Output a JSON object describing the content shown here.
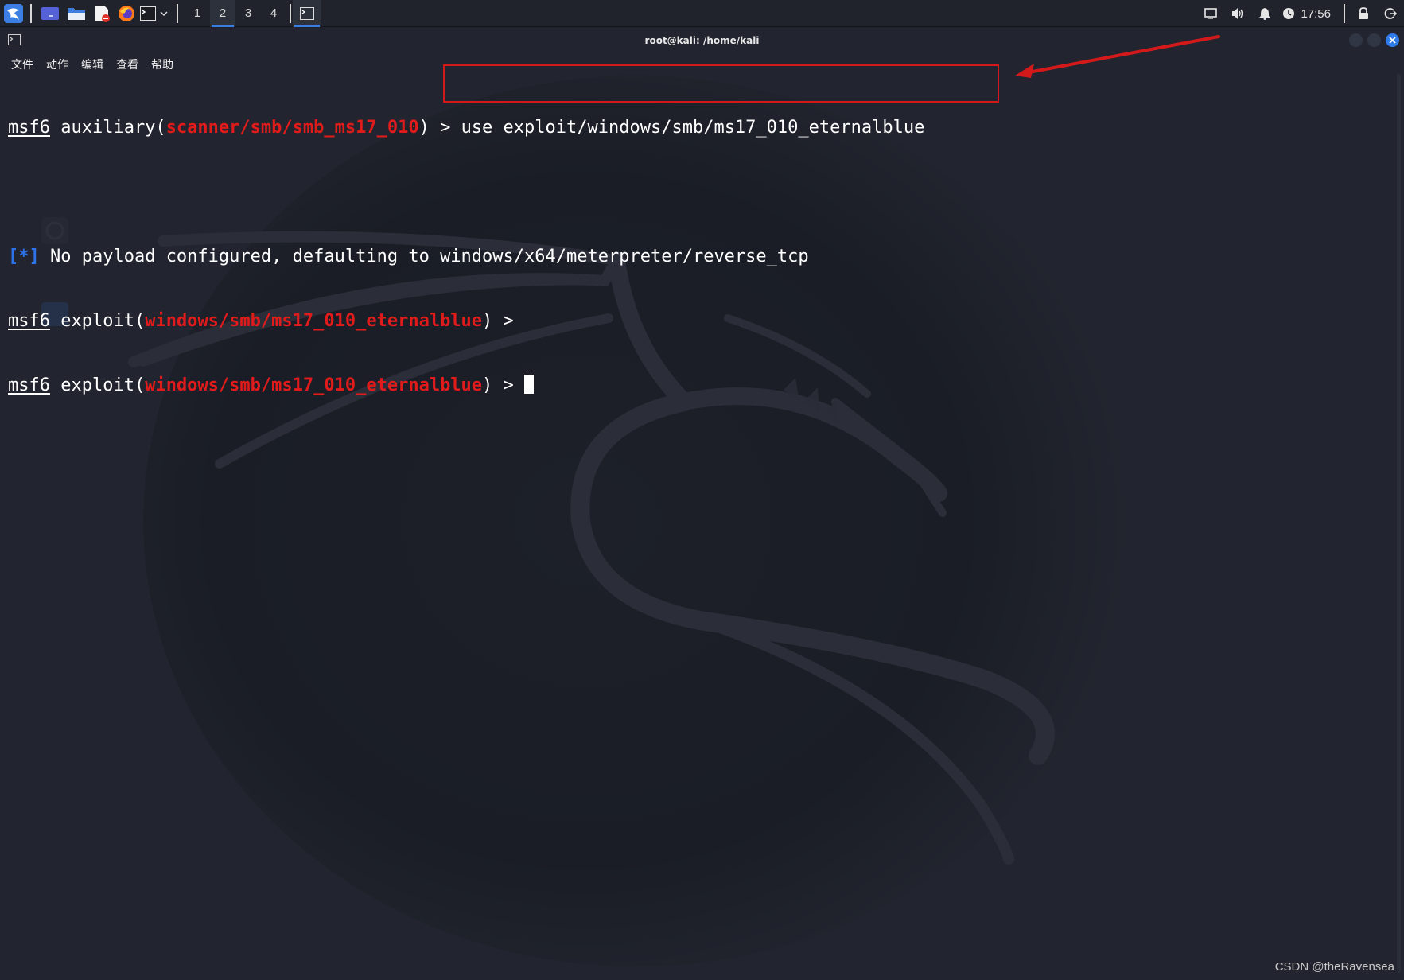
{
  "taskbar": {
    "workspaces": [
      "1",
      "2",
      "3",
      "4"
    ],
    "active_workspace": "2",
    "clock": "17:56",
    "accent_color": "#3a7fe0"
  },
  "window": {
    "title": "root@kali: /home/kali",
    "menu": [
      "文件",
      "动作",
      "编辑",
      "查看",
      "帮助"
    ]
  },
  "terminal": {
    "line1": {
      "prompt": "msf6",
      "module_type": " auxiliary(",
      "module": "scanner/smb/smb_ms17_010",
      "close": ") > ",
      "command": "use exploit/windows/smb/ms17_010_eternalblue"
    },
    "line2": {
      "marker": "[*]",
      "text": " No payload configured, defaulting to windows/x64/meterpreter/reverse_tcp"
    },
    "line3": {
      "prompt": "msf6",
      "module_type": " exploit(",
      "module": "windows/smb/ms17_010_eternalblue",
      "close": ") >"
    },
    "line4": {
      "prompt": "msf6",
      "module_type": " exploit(",
      "module": "windows/smb/ms17_010_eternalblue",
      "close": ") > "
    },
    "colors": {
      "module": "#e01b1b",
      "marker": "#2e72ea",
      "annotation": "#d4191b"
    }
  },
  "watermark": "CSDN @theRavensea"
}
